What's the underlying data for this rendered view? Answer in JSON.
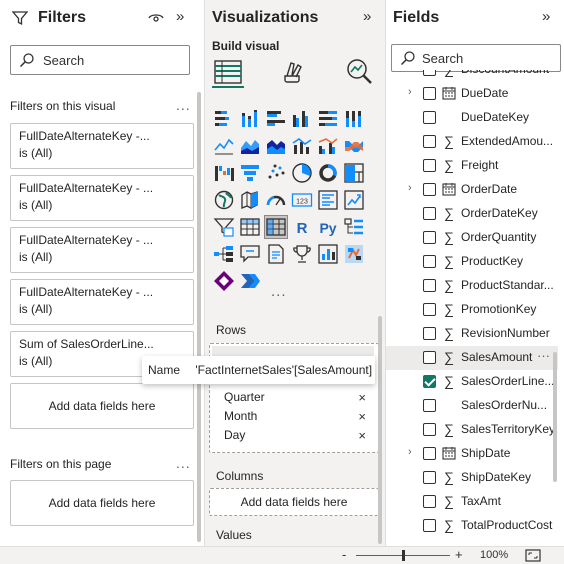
{
  "filters": {
    "title": "Filters",
    "search_placeholder": "Search",
    "on_visual_label": "Filters on this visual",
    "cards": [
      {
        "name": "FullDateAlternateKey -...",
        "state": "is (All)"
      },
      {
        "name": "FullDateAlternateKey - ...",
        "state": "is (All)"
      },
      {
        "name": "FullDateAlternateKey - ...",
        "state": "is (All)"
      },
      {
        "name": "FullDateAlternateKey - ...",
        "state": "is (All)"
      },
      {
        "name": "Sum of SalesOrderLine...",
        "state": "is (All)"
      }
    ],
    "add_fields": "Add data fields here",
    "on_page_label": "Filters on this page",
    "page_add_fields": "Add data fields here",
    "more": "..."
  },
  "visualizations": {
    "title": "Visualizations",
    "build_visual": "Build visual",
    "more_visuals": "...",
    "rows_label": "Rows",
    "rows_items": [
      "Quarter",
      "Month",
      "Day"
    ],
    "remove_glyph": "×",
    "columns_label": "Columns",
    "columns_add": "Add data fields here",
    "values_label": "Values",
    "tiles": [
      "stacked-bar-chart",
      "stacked-column-chart",
      "clustered-bar-chart",
      "clustered-column-chart",
      "100-stacked-bar-chart",
      "100-stacked-column-chart",
      "line-chart",
      "area-chart",
      "stacked-area-chart",
      "line-and-column-chart",
      "line-and-clustered-column-chart",
      "ribbon-chart",
      "waterfall-chart",
      "funnel-chart",
      "scatter-chart",
      "pie-chart",
      "donut-chart",
      "treemap",
      "map",
      "filled-map",
      "gauge",
      "card",
      "multi-row-card",
      "kpi",
      "slicer",
      "table",
      "matrix",
      "r-visual",
      "python-visual",
      "key-influencers",
      "decomposition-tree",
      "qa-visual",
      "smart-narrative",
      "paginated-report",
      "power-apps",
      "power-automate",
      "power-bi-bot",
      "chevron-visual"
    ],
    "r_letter": "R",
    "py_letters": "Py",
    "card_number": "123"
  },
  "fields": {
    "title": "Fields",
    "search_placeholder": "Search",
    "items": [
      {
        "name": "DiscountAmount",
        "type": "sum",
        "checked": false,
        "expand": false
      },
      {
        "name": "DueDate",
        "type": "date",
        "checked": false,
        "expand": true
      },
      {
        "name": "DueDateKey",
        "type": "none",
        "checked": false,
        "expand": false
      },
      {
        "name": "ExtendedAmou...",
        "type": "sum",
        "checked": false,
        "expand": false
      },
      {
        "name": "Freight",
        "type": "sum",
        "checked": false,
        "expand": false
      },
      {
        "name": "OrderDate",
        "type": "date",
        "checked": false,
        "expand": true
      },
      {
        "name": "OrderDateKey",
        "type": "sum",
        "checked": false,
        "expand": false
      },
      {
        "name": "OrderQuantity",
        "type": "sum",
        "checked": false,
        "expand": false
      },
      {
        "name": "ProductKey",
        "type": "sum",
        "checked": false,
        "expand": false
      },
      {
        "name": "ProductStandar...",
        "type": "sum",
        "checked": false,
        "expand": false
      },
      {
        "name": "PromotionKey",
        "type": "sum",
        "checked": false,
        "expand": false
      },
      {
        "name": "RevisionNumber",
        "type": "sum",
        "checked": false,
        "expand": false
      },
      {
        "name": "SalesAmount",
        "type": "sum",
        "checked": false,
        "expand": false,
        "hover": true
      },
      {
        "name": "SalesOrderLine...",
        "type": "sum",
        "checked": true,
        "expand": false
      },
      {
        "name": "SalesOrderNu...",
        "type": "none",
        "checked": false,
        "expand": false
      },
      {
        "name": "SalesTerritoryKey",
        "type": "sum",
        "checked": false,
        "expand": false
      },
      {
        "name": "ShipDate",
        "type": "date",
        "checked": false,
        "expand": true
      },
      {
        "name": "ShipDateKey",
        "type": "sum",
        "checked": false,
        "expand": false
      },
      {
        "name": "TaxAmt",
        "type": "sum",
        "checked": false,
        "expand": false
      },
      {
        "name": "TotalProductCost",
        "type": "sum",
        "checked": false,
        "expand": false
      }
    ],
    "row_more": "···",
    "sum_glyph": "∑",
    "expand_glyph": "›"
  },
  "tooltip": {
    "key": "Name",
    "value": "'FactInternetSales'[SalesAmount]"
  },
  "status": {
    "zoom_minus": "-",
    "zoom_plus": "+",
    "zoom_level": "100%",
    "zoom_fraction": 0.5
  },
  "colors": {
    "accent": "#117865",
    "pane_bg": "#f3f2f1",
    "chart_blue": "#118dff",
    "chart_navy": "#12239e",
    "chart_orange": "#e66c37",
    "chart_purple": "#6b007b"
  }
}
